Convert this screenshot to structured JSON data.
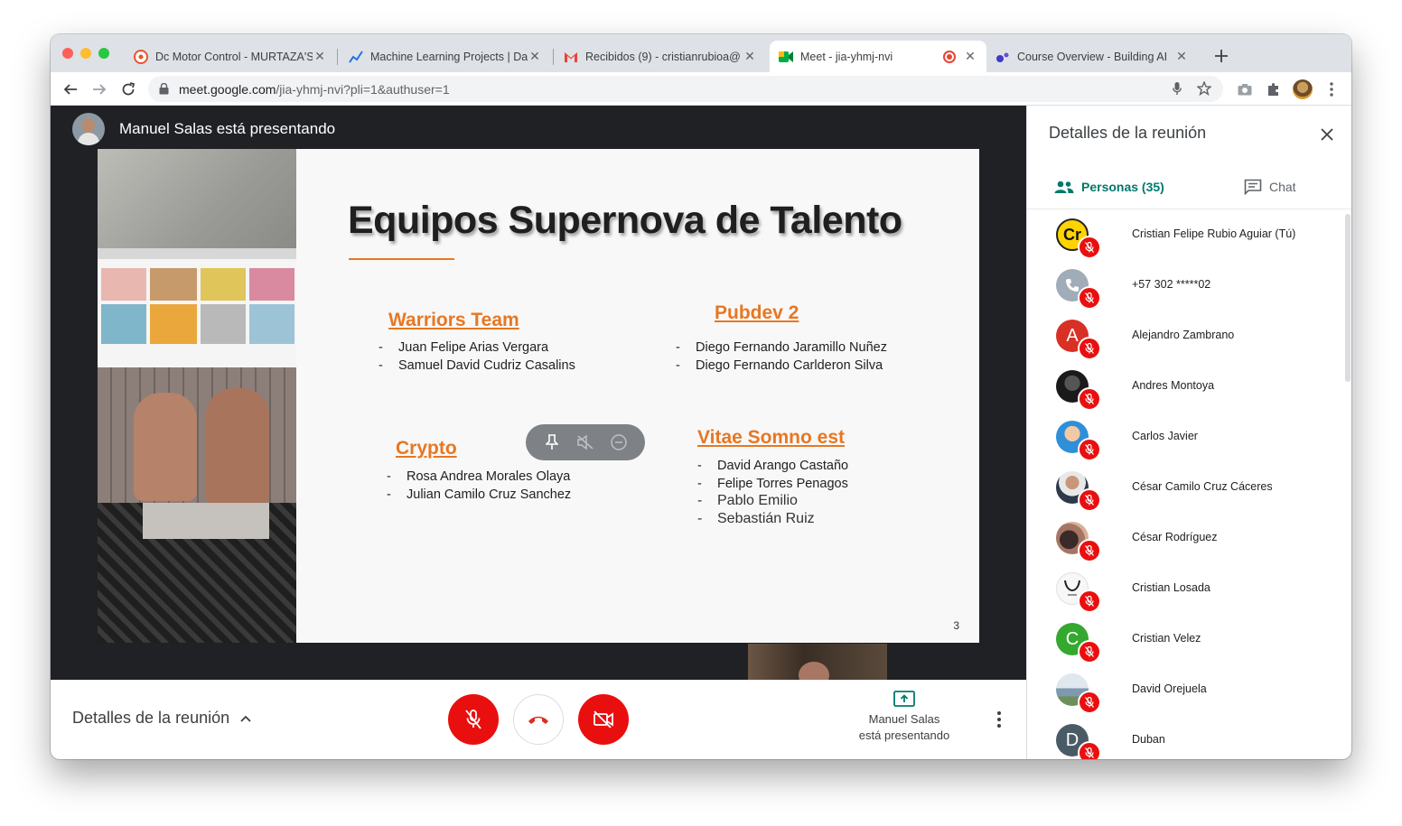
{
  "browser": {
    "tabs": [
      {
        "title": "Dc Motor Control - MURTAZA'S",
        "icon": "robot-favicon"
      },
      {
        "title": "Machine Learning Projects | Da",
        "icon": "chart-favicon"
      },
      {
        "title": "Recibidos (9) - cristianrubioa@",
        "icon": "gmail-favicon"
      },
      {
        "title": "Meet - jia-yhmj-nvi",
        "icon": "meet-favicon",
        "active": true
      },
      {
        "title": "Course Overview - Building AI",
        "icon": "course-favicon"
      }
    ],
    "url_host": "meet.google.com",
    "url_path": "/jia-yhmj-nvi?pli=1&authuser=1"
  },
  "presenter": {
    "banner": "Manuel Salas está presentando"
  },
  "slide": {
    "title": "Equipos Supernova de Talento",
    "page_number": "3",
    "teams": [
      {
        "name": "Warriors Team",
        "members": [
          "Juan Felipe Arias Vergara",
          "Samuel David Cudriz Casalins"
        ]
      },
      {
        "name": "Pubdev 2",
        "members": [
          "Diego Fernando Jaramillo Nuñez",
          "Diego Fernando Carlderon Silva"
        ]
      },
      {
        "name": "Crypto",
        "members": [
          "Rosa Andrea Morales Olaya",
          "Julian Camilo Cruz Sanchez"
        ]
      },
      {
        "name": "Vitae Somno est",
        "members": [
          "David Arango Castaño",
          "Felipe Torres Penagos",
          "Pablo Emilio",
          "Sebastián Ruiz"
        ]
      }
    ],
    "dash": "-"
  },
  "bottom_bar": {
    "meeting_details": "Detalles de la reunión",
    "present_line1": "Manuel Salas",
    "present_line2": "está presentando"
  },
  "panel": {
    "title": "Detalles de la reunión",
    "tab_people": "Personas (35)",
    "tab_chat": "Chat",
    "people": [
      {
        "name": "Cristian Felipe Rubio Aguiar (Tú)",
        "initial": "Cr",
        "color": "#ffd400"
      },
      {
        "name": "+57 302 *****02",
        "initial": "",
        "color": "#a0acb8"
      },
      {
        "name": "Alejandro Zambrano",
        "initial": "A",
        "color": "#d93025"
      },
      {
        "name": "Andres Montoya",
        "initial": "",
        "color": "#222222"
      },
      {
        "name": "Carlos Javier",
        "initial": "",
        "color": "#2f8fd8"
      },
      {
        "name": "César Camilo Cruz Cáceres",
        "initial": "",
        "color": "#e8e8e8"
      },
      {
        "name": "César Rodríguez",
        "initial": "",
        "color": "#8a5a4a"
      },
      {
        "name": "Cristian Losada",
        "initial": "",
        "color": "#f2f2f2"
      },
      {
        "name": "Cristian Velez",
        "initial": "C",
        "color": "#34a82f"
      },
      {
        "name": "David Orejuela",
        "initial": "",
        "color": "#9bb2c9"
      },
      {
        "name": "Duban",
        "initial": "D",
        "color": "#4a5b66"
      }
    ]
  },
  "colors": {
    "accent": "#00796b",
    "danger": "#ea0f0f",
    "slide_accent": "#e87722"
  }
}
